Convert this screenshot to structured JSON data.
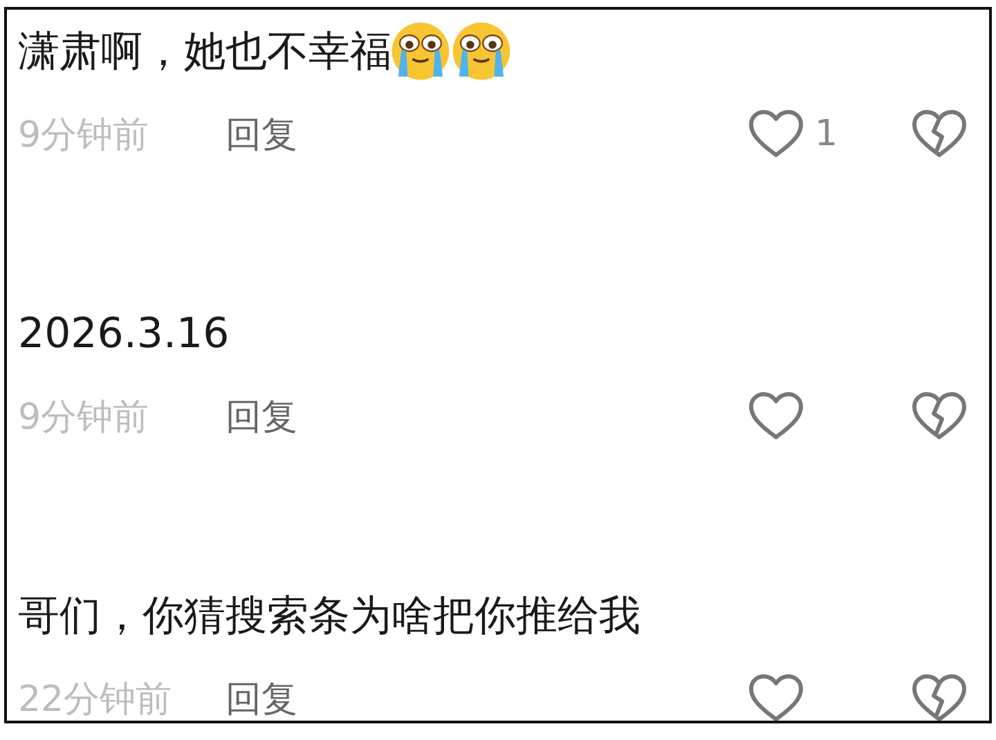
{
  "comments": [
    {
      "text": "潇肃啊，她也不幸福",
      "emojis": [
        {
          "kind": "crying"
        },
        {
          "kind": "crying"
        }
      ],
      "time": "9分钟前",
      "reply": "回复",
      "like_count": "1"
    },
    {
      "text": "2026.3.16",
      "time": "9分钟前",
      "reply": "回复"
    },
    {
      "text": "哥们，你猜搜索条为啥把你推给我",
      "time": "22分钟前",
      "reply": "回复"
    }
  ]
}
